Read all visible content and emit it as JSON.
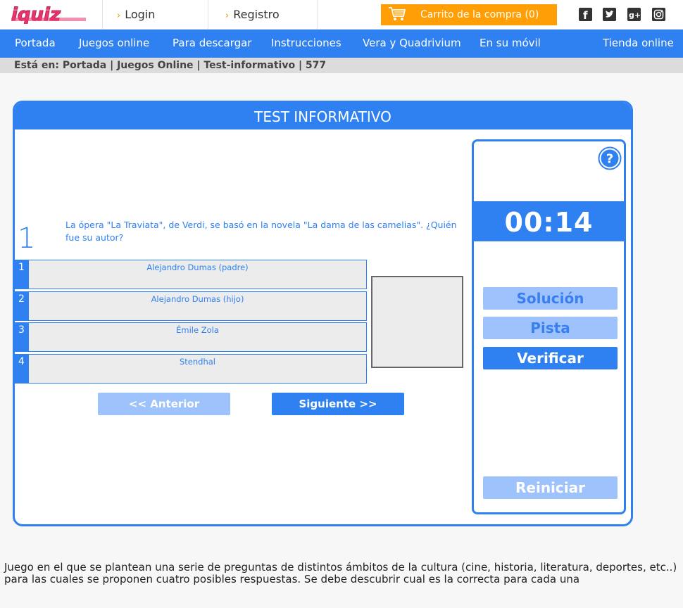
{
  "header": {
    "logo_text": "iquiz",
    "login": "Login",
    "register": "Registro",
    "cart": "Carrito de la compra (0)",
    "social": [
      "facebook-icon",
      "twitter-icon",
      "googleplus-icon",
      "instagram-icon"
    ]
  },
  "nav": {
    "items": [
      "Portada",
      "Juegos online",
      "Para descargar",
      "Instrucciones",
      "Vera y Quadrivium",
      "En su móvil",
      "Tienda online"
    ]
  },
  "breadcrumb": "Está en: Portada | Juegos Online | Test-informativo | 577",
  "quiz": {
    "title": "TEST INFORMATIVO",
    "question_number": "1",
    "question": "La ópera \"La Traviata\", de Verdi, se basó en la novela \"La dama de las camelias\". ¿Quién fue su autor?",
    "answers": [
      {
        "num": "1",
        "text": "Alejandro Dumas (padre)"
      },
      {
        "num": "2",
        "text": "Alejandro Dumas (hijo)"
      },
      {
        "num": "3",
        "text": "Émile Zola"
      },
      {
        "num": "4",
        "text": "Stendhal"
      }
    ],
    "prev": "<< Anterior",
    "next": "Siguiente >>"
  },
  "side": {
    "help": "?",
    "timer": "00:14",
    "solution": "Solución",
    "hint": "Pista",
    "verify": "Verificar",
    "reset": "Reiniciar"
  },
  "description": "Juego en el que se plantean una serie de preguntas de distintos ámbitos de la cultura (cine, historia, literatura, deportes, etc..) para las cuales se proponen cuatro posibles respuestas. Se debe descubrir cual es la correcta para cada una",
  "colors": {
    "primary": "#2f80f0",
    "light": "#9ec2fb",
    "cart": "#ff9f05",
    "logo": "#e8356e"
  }
}
